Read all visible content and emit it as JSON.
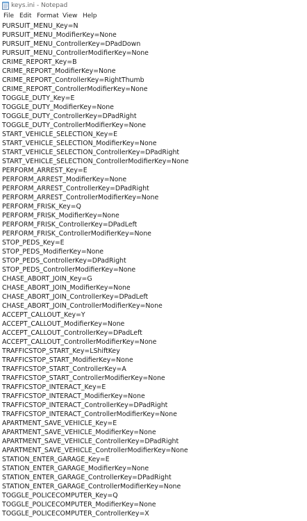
{
  "window": {
    "title": "keys.ini - Notepad",
    "icon": "notepad-icon"
  },
  "menubar": {
    "items": [
      "File",
      "Edit",
      "Format",
      "View",
      "Help"
    ]
  },
  "editor": {
    "lines": [
      "PURSUIT_MENU_Key=N",
      "PURSUIT_MENU_ModifierKey=None",
      "PURSUIT_MENU_ControllerKey=DPadDown",
      "PURSUIT_MENU_ControllerModifierKey=None",
      "CRIME_REPORT_Key=B",
      "CRIME_REPORT_ModifierKey=None",
      "CRIME_REPORT_ControllerKey=RightThumb",
      "CRIME_REPORT_ControllerModifierKey=None",
      "TOGGLE_DUTY_Key=E",
      "TOGGLE_DUTY_ModifierKey=None",
      "TOGGLE_DUTY_ControllerKey=DPadRight",
      "TOGGLE_DUTY_ControllerModifierKey=None",
      "START_VEHICLE_SELECTION_Key=E",
      "START_VEHICLE_SELECTION_ModifierKey=None",
      "START_VEHICLE_SELECTION_ControllerKey=DPadRight",
      "START_VEHICLE_SELECTION_ControllerModifierKey=None",
      "PERFORM_ARREST_Key=E",
      "PERFORM_ARREST_ModifierKey=None",
      "PERFORM_ARREST_ControllerKey=DPadRight",
      "PERFORM_ARREST_ControllerModifierKey=None",
      "PERFORM_FRISK_Key=Q",
      "PERFORM_FRISK_ModifierKey=None",
      "PERFORM_FRISK_ControllerKey=DPadLeft",
      "PERFORM_FRISK_ControllerModifierKey=None",
      "STOP_PEDS_Key=E",
      "STOP_PEDS_ModifierKey=None",
      "STOP_PEDS_ControllerKey=DPadRight",
      "STOP_PEDS_ControllerModifierKey=None",
      "CHASE_ABORT_JOIN_Key=G",
      "CHASE_ABORT_JOIN_ModifierKey=None",
      "CHASE_ABORT_JOIN_ControllerKey=DPadLeft",
      "CHASE_ABORT_JOIN_ControllerModifierKey=None",
      "ACCEPT_CALLOUT_Key=Y",
      "ACCEPT_CALLOUT_ModifierKey=None",
      "ACCEPT_CALLOUT_ControllerKey=DPadLeft",
      "ACCEPT_CALLOUT_ControllerModifierKey=None",
      "TRAFFICSTOP_START_Key=LShiftKey",
      "TRAFFICSTOP_START_ModifierKey=None",
      "TRAFFICSTOP_START_ControllerKey=A",
      "TRAFFICSTOP_START_ControllerModifierKey=None",
      "TRAFFICSTOP_INTERACT_Key=E",
      "TRAFFICSTOP_INTERACT_ModifierKey=None",
      "TRAFFICSTOP_INTERACT_ControllerKey=DPadRight",
      "TRAFFICSTOP_INTERACT_ControllerModifierKey=None",
      "APARTMENT_SAVE_VEHICLE_Key=E",
      "APARTMENT_SAVE_VEHICLE_ModifierKey=None",
      "APARTMENT_SAVE_VEHICLE_ControllerKey=DPadRight",
      "APARTMENT_SAVE_VEHICLE_ControllerModifierKey=None",
      "STATION_ENTER_GARAGE_Key=E",
      "STATION_ENTER_GARAGE_ModifierKey=None",
      "STATION_ENTER_GARAGE_ControllerKey=DPadRight",
      "STATION_ENTER_GARAGE_ControllerModifierKey=None",
      "TOGGLE_POLICECOMPUTER_Key=Q",
      "TOGGLE_POLICECOMPUTER_ModifierKey=None",
      "TOGGLE_POLICECOMPUTER_ControllerKey=X"
    ]
  }
}
